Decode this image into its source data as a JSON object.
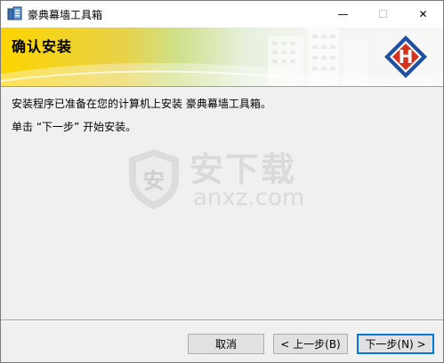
{
  "window": {
    "title": "豪典幕墙工具箱",
    "controls": {
      "minimize": "—",
      "maximize": "☐",
      "close": "✕"
    }
  },
  "banner": {
    "title": "确认安装",
    "logo_letter": "H",
    "colors": {
      "logo_blue": "#1f4fa0",
      "logo_red": "#d6301f",
      "banner_yellow": "#fcd400"
    }
  },
  "content": {
    "line1": "安装程序已准备在您的计算机上安装 豪典幕墙工具箱。",
    "line2": "单击 “下一步” 开始安装。"
  },
  "watermark": {
    "title": "安下载",
    "url": "anxz.com",
    "icon_char": "安"
  },
  "buttons": {
    "cancel": "取消",
    "back": "< 上一步(B)",
    "next": "下一步(N) >"
  }
}
